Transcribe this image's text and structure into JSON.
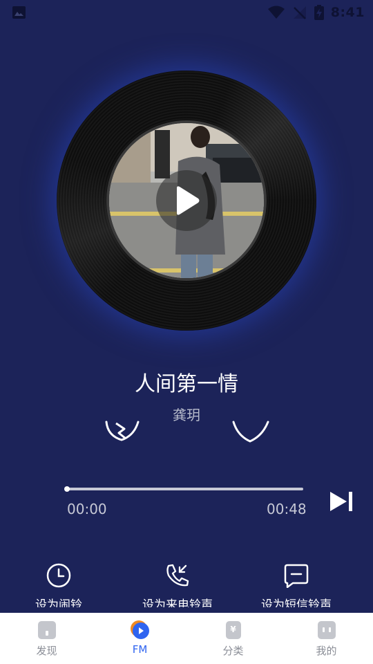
{
  "status_bar": {
    "time": "8:41"
  },
  "player": {
    "song_title": "人间第一情",
    "artist": "龚玥",
    "current_time": "00:00",
    "total_time": "00:48",
    "progress": 0.0
  },
  "actions": [
    {
      "label": "设为闹铃",
      "icon": "alarm-clock-icon"
    },
    {
      "label": "设为来电铃声",
      "icon": "phone-callback-icon"
    },
    {
      "label": "设为短信铃声",
      "icon": "message-icon"
    }
  ],
  "tabs": [
    {
      "label": "发现",
      "icon": "discover-icon",
      "active": false
    },
    {
      "label": "FM",
      "icon": "fm-play-icon",
      "active": true
    },
    {
      "label": "分类",
      "icon": "category-yen-icon",
      "active": false
    },
    {
      "label": "我的",
      "icon": "profile-icon",
      "active": false
    }
  ],
  "colors": {
    "background": "#1c2359",
    "tab_active": "#2f64f0",
    "tab_inactive": "#8a8d96",
    "progress_track": "#c7c9d6"
  }
}
